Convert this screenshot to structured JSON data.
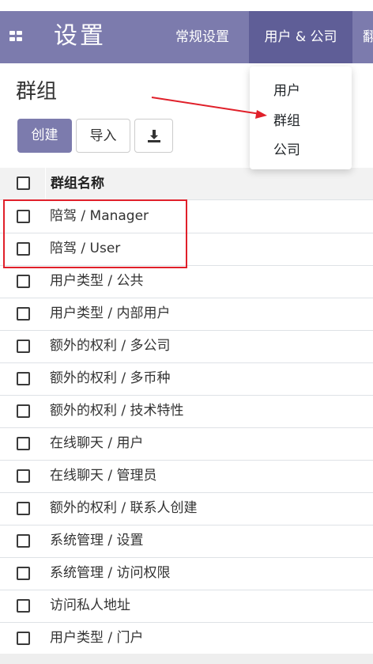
{
  "navbar": {
    "brand": "设置",
    "menu": [
      "常规设置",
      "用户 & 公司",
      "翻"
    ]
  },
  "dropdown": {
    "items": [
      "用户",
      "群组",
      "公司"
    ]
  },
  "page": {
    "title": "群组"
  },
  "toolbar": {
    "create_label": "创建",
    "import_label": "导入"
  },
  "table": {
    "column_header": "群组名称",
    "rows": [
      "陪驾 / Manager",
      "陪驾 / User",
      "用户类型 / 公共",
      "用户类型 / 内部用户",
      "额外的权利 / 多公司",
      "额外的权利 / 多币种",
      "额外的权利 / 技术特性",
      "在线聊天 / 用户",
      "在线聊天 / 管理员",
      "额外的权利 / 联系人创建",
      "系统管理 / 设置",
      "系统管理 / 访问权限",
      "访问私人地址",
      "用户类型 / 门户"
    ]
  },
  "colors": {
    "navbar": "#7c7bad",
    "navbar_active": "#5f5e97",
    "annotation": "#e0202a"
  },
  "icons": [
    "apps-grid-icon",
    "download-icon",
    "checkbox-icon",
    "annotation-arrow-icon"
  ]
}
